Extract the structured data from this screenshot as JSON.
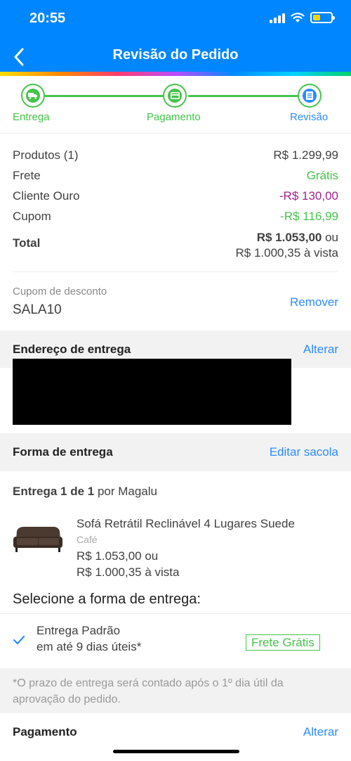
{
  "status_bar": {
    "time": "20:55"
  },
  "header": {
    "title": "Revisão do Pedido"
  },
  "stepper": {
    "steps": [
      {
        "label": "Entrega",
        "icon": "truck-icon"
      },
      {
        "label": "Pagamento",
        "icon": "card-icon"
      },
      {
        "label": "Revisão",
        "icon": "document-icon"
      }
    ]
  },
  "summary": {
    "rows": [
      {
        "label": "Produtos (1)",
        "value": "R$ 1.299,99"
      },
      {
        "label": "Frete",
        "value": "Grátis"
      },
      {
        "label": "Cliente Ouro",
        "value": "-R$ 130,00"
      },
      {
        "label": "Cupom",
        "value": "-R$ 116,99"
      }
    ],
    "total_label": "Total",
    "total_value": "R$ 1.053,00",
    "total_or": " ou",
    "total_cash": "R$ 1.000,35 à vista"
  },
  "coupon": {
    "label": "Cupom de desconto",
    "code": "SALA10",
    "remove": "Remover"
  },
  "address": {
    "title": "Endereço de entrega",
    "action": "Alterar"
  },
  "delivery": {
    "title": "Forma de entrega",
    "action": "Editar sacola",
    "count_prefix": "Entrega 1 de 1",
    "count_suffix": " por Magalu"
  },
  "product": {
    "name": "Sofá Retrátil Reclinável 4 Lugares Suede",
    "variant": "Café",
    "price": "R$ 1.053,00 ou",
    "cash": "R$ 1.000,35 à vista"
  },
  "shipping": {
    "select_title": "Selecione a forma de entrega:",
    "option_name": "Entrega Padrão",
    "option_time": "em até 9 dias úteis*",
    "badge": "Frete Grátis"
  },
  "note": "*O prazo de entrega será contado após o 1º dia útil da aprovação do pedido.",
  "payment": {
    "title": "Pagamento",
    "action": "Alterar"
  },
  "colors": {
    "primary": "#0086ff",
    "green": "#46c34b",
    "purple": "#a1248b",
    "link": "#2b8cff"
  }
}
